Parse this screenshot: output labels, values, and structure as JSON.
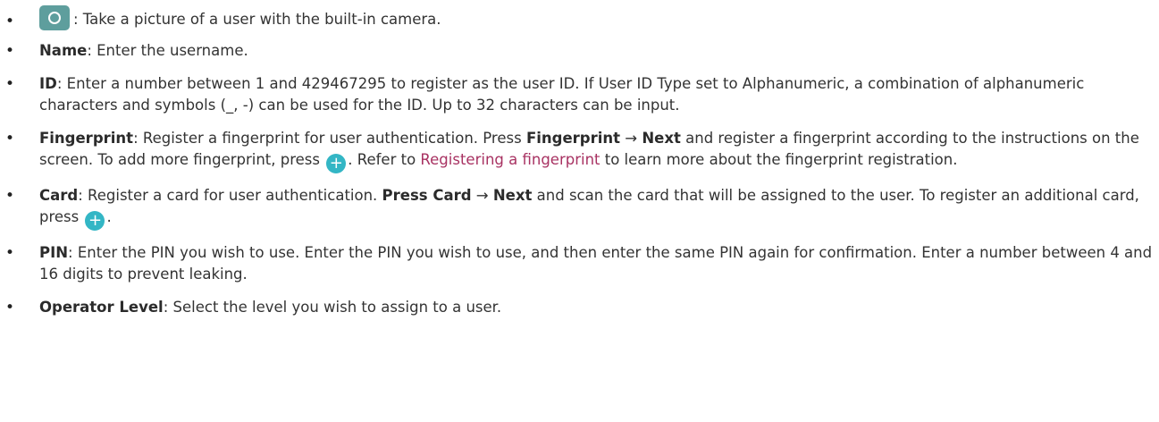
{
  "items": [
    {
      "text": ": Take a picture of a user with the built-in camera."
    },
    {
      "term": "Name",
      "text": ": Enter the username."
    },
    {
      "term": "ID",
      "text": ": Enter a number between 1 and 429467295 to register as the user ID. If User ID Type set to Alphanumeric, a combination of alphanumeric characters and symbols (_, -) can be used for the ID. Up to 32 characters can be input."
    },
    {
      "term": "Fingerprint",
      "t1": ": Register a fingerprint for user authentication. Press ",
      "b1": "Fingerprint",
      "arrow": " → ",
      "b2": "Next",
      "t2": " and register a fingerprint according to the instructions on the screen. To add more fingerprint, press ",
      "plus": "+",
      "t3": ". Refer to ",
      "link": "Registering a fingerprint",
      "t4": " to learn more about the fingerprint registration."
    },
    {
      "term": "Card",
      "t1": ": Register a card for user authentication. ",
      "b1": "Press Card",
      "arrow": " → ",
      "b2": "Next",
      "t2": " and scan the card that will be assigned to the user. To register an additional card, press ",
      "plus": "+",
      "t3": "."
    },
    {
      "term": "PIN",
      "text": ": Enter the PIN you wish to use. Enter the PIN you wish to use, and then enter the same PIN again for confirmation. Enter a number between 4 and 16 digits to prevent leaking."
    },
    {
      "term": "Operator Level",
      "text": ": Select the level you wish to assign to a user."
    }
  ]
}
